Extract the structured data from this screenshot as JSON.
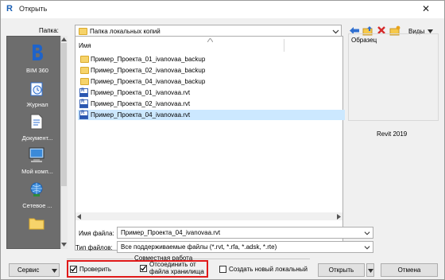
{
  "window": {
    "title": "Открыть",
    "close_glyph": "✕"
  },
  "folder": {
    "label": "Папка:",
    "value": "Папка локальных копий"
  },
  "toolbar": {
    "views_label": "Виды"
  },
  "places": [
    {
      "label": "BIM 360",
      "icon": "bim360-icon"
    },
    {
      "label": "Журнал",
      "icon": "history-icon"
    },
    {
      "label": "Документ...",
      "icon": "documents-icon"
    },
    {
      "label": "Мой комп...",
      "icon": "computer-icon"
    },
    {
      "label": "Сетевое ...",
      "icon": "network-icon"
    }
  ],
  "filelist": {
    "column_name": "Имя",
    "items": [
      {
        "name": "Пример_Проекта_01_ivanovaa_backup",
        "type": "folder"
      },
      {
        "name": "Пример_Проекта_02_ivanovaa_backup",
        "type": "folder"
      },
      {
        "name": "Пример_Проекта_04_ivanovaa_backup",
        "type": "folder"
      },
      {
        "name": "Пример_Проекта_01_ivanovaa.rvt",
        "type": "rvt"
      },
      {
        "name": "Пример_Проекта_02_ivanovaa.rvt",
        "type": "rvt"
      },
      {
        "name": "Пример_Проекта_04_ivanovaa.rvt",
        "type": "rvt",
        "selected": true
      }
    ]
  },
  "preview": {
    "label": "Образец",
    "version": "Revit 2019"
  },
  "filename": {
    "label": "Имя файла:",
    "value": "Пример_Проекта_04_ivanovaa.rvt"
  },
  "filetype": {
    "label": "Тип файлов:",
    "value": "Все поддерживаемые файлы  (*.rvt, *.rfa, *.adsk, *.rte)"
  },
  "worksharing": {
    "group_label": "Совместная работа",
    "audit_label": "Проверить",
    "audit_checked": true,
    "detach_label_1": "Отсоединить от",
    "detach_label_2": "файла хранилища",
    "detach_checked": true,
    "new_local_label": "Создать новый локальный",
    "new_local_checked": false
  },
  "buttons": {
    "tools": "Сервис",
    "open": "Открыть",
    "cancel": "Отмена"
  },
  "colors": {
    "highlight": "#e01919",
    "selection": "#cce8ff",
    "places_bg": "#6d6d6d"
  }
}
